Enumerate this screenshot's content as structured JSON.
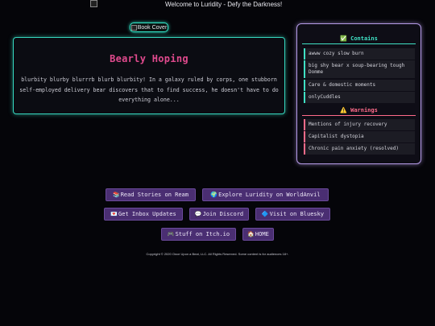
{
  "banner": {
    "alt_text": "Welcome to Luridity - Defy the Darkness!"
  },
  "cover": {
    "alt_text": "Book Cover"
  },
  "book": {
    "title": "Bearly Hoping",
    "description": "blurbity blurby blurrrb blurb blurbity! In a galaxy ruled by corps, one stubborn self-employed delivery bear discovers that to find success, he doesn't have to do everything alone..."
  },
  "contains": {
    "icon": "✅",
    "title": "Contains",
    "items": [
      "awww cozy slow burn",
      "big shy bear x soup-bearing tough Domme",
      "Care & domestic moments",
      "onlyCuddles"
    ]
  },
  "warnings": {
    "icon": "⚠️",
    "title": "Warnings",
    "items": [
      "Mentions of injury recovery",
      "Capitalist dystopia",
      "Chronic pain anxiety (resolved)"
    ]
  },
  "links": [
    {
      "icon": "📚",
      "label": "Read Stories on Ream"
    },
    {
      "icon": "🌍",
      "label": "Explore Luridity on WorldAnvil"
    },
    {
      "icon": "💌",
      "label": "Get Inbox Updates"
    },
    {
      "icon": "💬",
      "label": "Join Discord"
    },
    {
      "icon": "🔷",
      "label": "Visit on Bluesky"
    },
    {
      "icon": "🎮",
      "label": "Stuff on Itch.io"
    },
    {
      "icon": "🏠",
      "label": "HOME"
    }
  ],
  "footer": {
    "copyright": "Copyright © 2020 Once Upon a Beat, LLC. All Rights Reserved. Some content is for audiences 18+."
  },
  "colors": {
    "accent_teal": "#36d9c0",
    "accent_pink": "#e04a8d",
    "accent_purple": "#b49ae6",
    "warn_red": "#ff6b8a",
    "button_bg": "#4a2e72"
  }
}
